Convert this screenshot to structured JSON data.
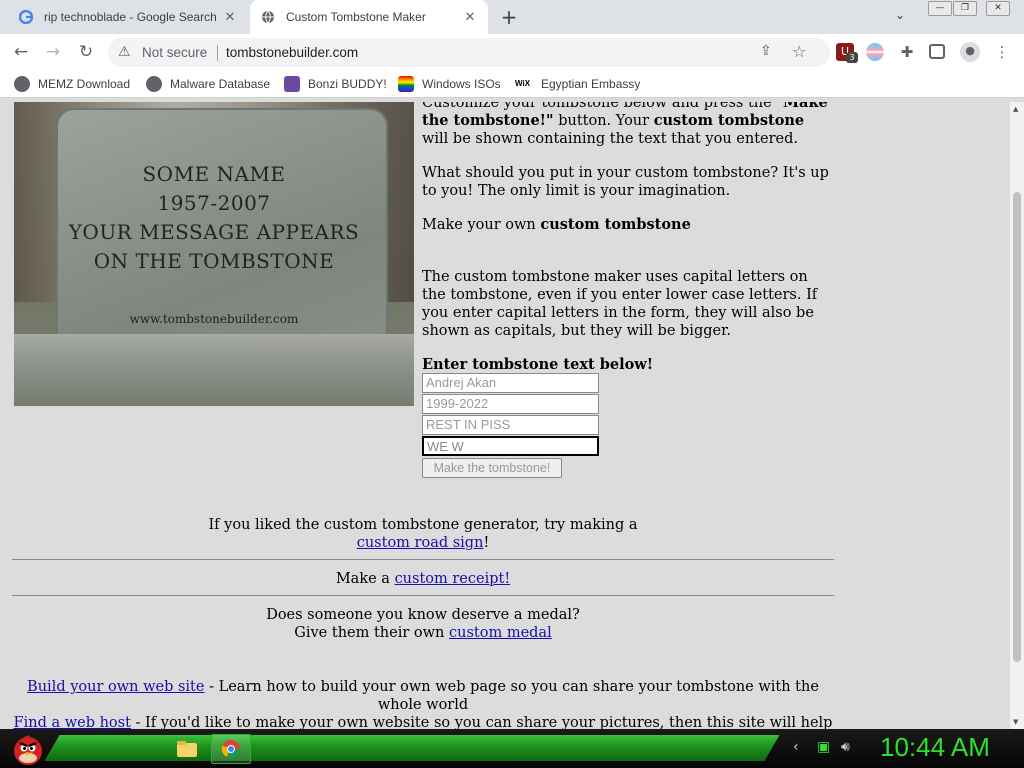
{
  "browser": {
    "tabs": [
      {
        "title": "rip technoblade - Google Search",
        "active": false,
        "favicon": "google-g-icon"
      },
      {
        "title": "Custom Tombstone Maker",
        "active": true,
        "favicon": "globe-icon"
      }
    ],
    "security_label": "Not secure",
    "url": "tombstonebuilder.com",
    "extension_badge": "3",
    "bookmarks": [
      {
        "label": "MEMZ Download",
        "icon": "globe-icon"
      },
      {
        "label": "Malware Database",
        "icon": "globe-icon"
      },
      {
        "label": "Bonzi BUDDY!",
        "icon": "bonzi-icon"
      },
      {
        "label": "Windows ISOs",
        "icon": "windows-icon"
      },
      {
        "label": "Egyptian Embassy",
        "icon": "wix-icon"
      }
    ]
  },
  "tombstone": {
    "line1": "SOME NAME",
    "line2": "1957-2007",
    "line3": "YOUR MESSAGE APPEARS",
    "line4": "ON THE TOMBSTONE",
    "watermark": "www.tombstonebuilder.com"
  },
  "intro": {
    "p1_a": "Customize your tombstone below and press the \"",
    "p1_b": "Make the tombstone!\"",
    "p1_c": " button. Your ",
    "p1_d": "custom tombstone",
    "p1_e": " will be shown containing the text that you entered.",
    "p2": "What should you put in your custom tombstone? It's up to you! The only limit is your imagination.",
    "p3_a": "Make your own ",
    "p3_b": "custom tombstone",
    "p4": "The custom tombstone maker uses capital letters on the tombstone, even if you enter lower case letters. If you enter capital letters in the form, they will also be shown as capitals, but they will be bigger."
  },
  "form": {
    "heading": "Enter tombstone text below!",
    "field1": "Andrej Akan",
    "field2": "1999-2022",
    "field3": "REST IN PISS",
    "field4": "WE W",
    "submit_label": "Make the tombstone!"
  },
  "promos": {
    "road_a": "If you liked the custom tombstone generator, try making a",
    "road_link": "custom road sign",
    "road_b": "!",
    "receipt_a": "Make a ",
    "receipt_link": "custom receipt!",
    "medal_a": "Does someone you know deserve a medal?",
    "medal_b": "Give them their own ",
    "medal_link": "custom medal",
    "build_link": "Build your own web site",
    "build_text": " - Learn how to build your own web page so you can share your tombstone with the whole world",
    "host_link": "Find a web host",
    "host_text": " - If you'd like to make your own website so you can share your pictures, then this site will help you find a great web host"
  },
  "taskbar": {
    "clock": "10:44 AM"
  }
}
